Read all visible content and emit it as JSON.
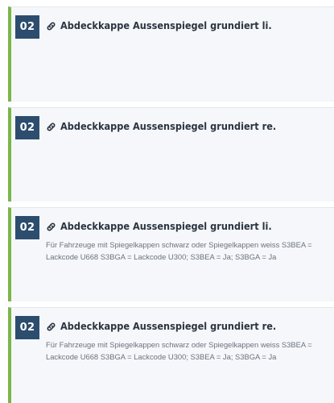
{
  "items": [
    {
      "number": "02",
      "title": "Abdeckkappe Aussenspiegel grundiert li.",
      "description": ""
    },
    {
      "number": "02",
      "title": "Abdeckkappe Aussenspiegel grundiert re.",
      "description": ""
    },
    {
      "number": "02",
      "title": "Abdeckkappe Aussenspiegel grundiert li.",
      "description": "Für Fahrzeuge mit Spiegelkappen schwarz oder Spiegelkappen weiss S3BEA = Lackcode U668 S3BGA = Lackcode U300; S3BEA = Ja; S3BGA = Ja"
    },
    {
      "number": "02",
      "title": "Abdeckkappe Aussenspiegel grundiert re.",
      "description": "Für Fahrzeuge mit Spiegelkappen schwarz oder Spiegelkappen weiss S3BEA = Lackcode U668 S3BGA = Lackcode U300; S3BEA = Ja; S3BGA = Ja"
    }
  ],
  "icons": {
    "title_icon": "link-icon"
  },
  "colors": {
    "accent_bar": "#7ab648",
    "badge_bg": "#2d4d6e",
    "card_bg": "#f5f7fa"
  }
}
